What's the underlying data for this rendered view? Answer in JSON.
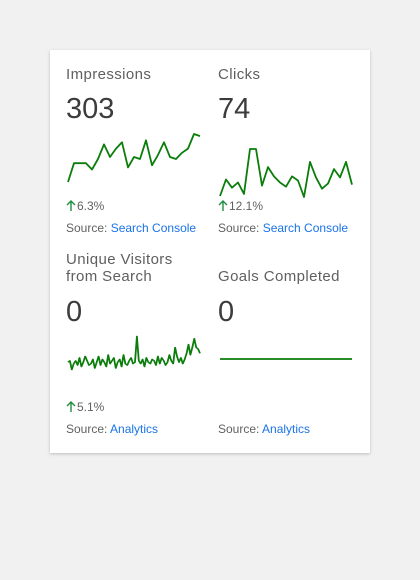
{
  "colors": {
    "sparkline": "#0a7d0a",
    "arrow": "#1e8e3e",
    "link": "#1a73e8"
  },
  "source_prefix": "Source:",
  "tiles": [
    {
      "title": "Impressions",
      "value": "303",
      "change": "6.3%",
      "trend": "up",
      "source_link": "Search Console",
      "spark": [
        6,
        24,
        24,
        24,
        18,
        28,
        42,
        30,
        38,
        44,
        20,
        30,
        28,
        46,
        22,
        32,
        44,
        30,
        28,
        34,
        38,
        52,
        50
      ]
    },
    {
      "title": "Clicks",
      "value": "74",
      "change": "12.1%",
      "trend": "up",
      "source_link": "Search Console",
      "spark": [
        4,
        36,
        20,
        30,
        8,
        95,
        95,
        24,
        60,
        42,
        30,
        22,
        42,
        34,
        2,
        70,
        40,
        18,
        28,
        56,
        40,
        70,
        26
      ]
    },
    {
      "title": "Unique Visitors from Search",
      "value": "0",
      "change": "5.1%",
      "trend": "up",
      "source_link": "Analytics",
      "spark": [
        20,
        22,
        10,
        18,
        22,
        16,
        26,
        14,
        20,
        28,
        22,
        16,
        18,
        24,
        12,
        20,
        28,
        16,
        24,
        20,
        14,
        30,
        18,
        22,
        26,
        12,
        20,
        24,
        14,
        30,
        18,
        16,
        22,
        26,
        18,
        20,
        55,
        22,
        18,
        24,
        14,
        26,
        20,
        18,
        24,
        22,
        16,
        28,
        18,
        26,
        22,
        16,
        20,
        30,
        22,
        18,
        40,
        28,
        20,
        26,
        18,
        24,
        32,
        44,
        30,
        40,
        52,
        40,
        38,
        32
      ]
    },
    {
      "title": "Goals Completed",
      "value": "0",
      "change": "",
      "trend": "flat",
      "source_link": "Analytics",
      "spark": [
        0,
        0,
        0,
        0,
        0,
        0,
        0,
        0,
        0,
        0
      ]
    }
  ]
}
